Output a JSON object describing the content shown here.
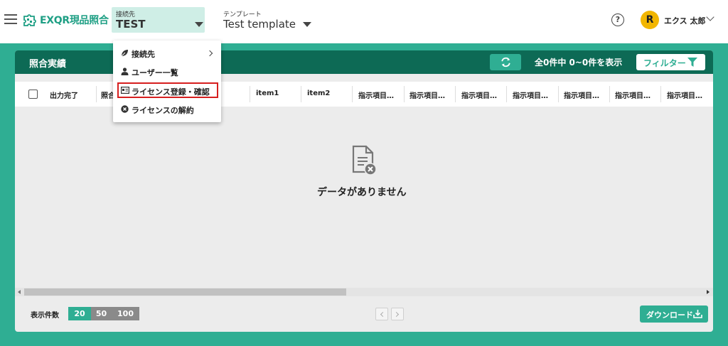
{
  "header": {
    "logo_text": "EXQR現品照合",
    "connection": {
      "small_label": "接続先",
      "value": "TEST"
    },
    "template": {
      "small_label": "テンプレート",
      "value": "Test template"
    },
    "help_glyph": "?",
    "user": {
      "initial": "R",
      "name": "エクス 太郎"
    }
  },
  "menu": {
    "items": [
      {
        "label": "接続先",
        "icon": "leaf-icon"
      },
      {
        "label": "ユーザー一覧",
        "icon": "user-icon"
      },
      {
        "label": "ライセンス登録・確認",
        "icon": "id-card-icon",
        "highlighted": true
      },
      {
        "label": "ライセンスの解約",
        "icon": "cancel-circle-icon"
      }
    ]
  },
  "panel": {
    "title": "照合実績",
    "count_text": "全0件中 0~0件を表示",
    "filter_label": "フィルター",
    "columns": [
      "出力完了",
      "照合",
      "",
      "item1",
      "item2",
      "指示項目…",
      "指示項目…",
      "指示項目…",
      "指示項目…",
      "指示項目…",
      "指示項目…",
      "指示項目…"
    ],
    "empty_message": "データがありません",
    "per_page_label": "表示件数",
    "per_page_options": [
      "20",
      "50",
      "100"
    ],
    "per_page_selected": "20",
    "download_label": "ダウンロード"
  },
  "colors": {
    "brand": "#2fae93",
    "header_dark": "#0d6a55",
    "connection_bg": "#cfeee6",
    "avatar": "#f2b600",
    "highlight_border": "#d61f1f"
  }
}
